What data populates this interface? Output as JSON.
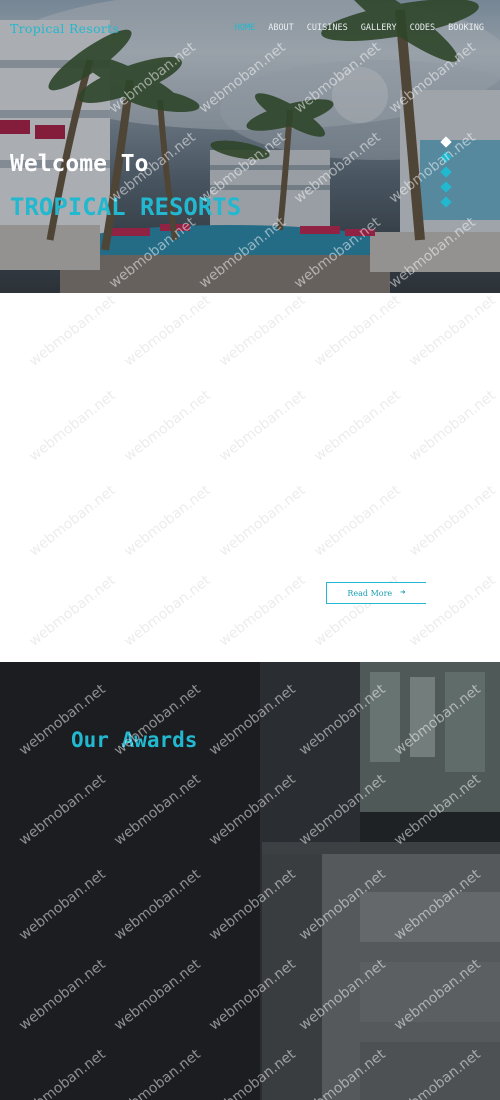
{
  "brand": "Tropical Resorts",
  "nav": {
    "items": [
      "HOME",
      "ABOUT",
      "CUISINES",
      "GALLERY",
      "CODES",
      "BOOKING"
    ],
    "active": "HOME"
  },
  "hero": {
    "line1": "Welcome To",
    "line2": "TROPICAL RESORTS",
    "slides": 5,
    "active_slide": 1
  },
  "middle": {
    "read_more_label": "Read More",
    "read_more_icon": "arrow-right-icon"
  },
  "awards": {
    "title": "Our Awards"
  },
  "watermark": "webmoban.net",
  "colors": {
    "accent": "#22b8cf",
    "dark": "#1c1e22"
  }
}
